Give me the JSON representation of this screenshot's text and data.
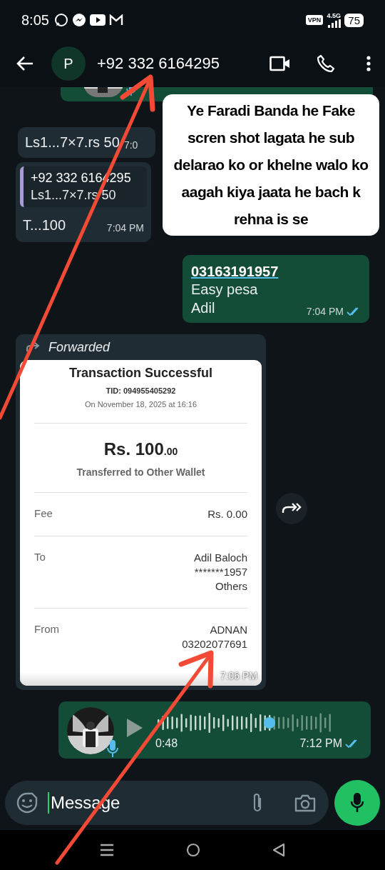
{
  "status_bar": {
    "time": "8:05",
    "vpn": "VPN",
    "network": "4.5G",
    "battery": "75"
  },
  "header": {
    "avatar_letter": "P",
    "contact": "+92 332 6164295"
  },
  "messages": [
    {
      "kind": "voice_partial"
    },
    {
      "kind": "text_in",
      "text": "Ls1...7×7.rs 50",
      "time": "7:0"
    },
    {
      "kind": "quote_in",
      "quote_author": "+92 332 6164295",
      "quote_text": "Ls1...7×7.rs 50",
      "text": "T...100",
      "time": "7:04 PM"
    },
    {
      "kind": "text_out",
      "link": "03163191957",
      "lines": [
        "Easy pesa",
        "Adil"
      ],
      "time": "7:04 PM",
      "read": true
    },
    {
      "kind": "receipt",
      "forwarded": "Forwarded",
      "title": "Transaction Successful",
      "tid": "TID: 094955405292",
      "date": "On November 18, 2025 at 16:16",
      "amount": "Rs. 100",
      "cents": ".00",
      "subtitle": "Transferred to Other Wallet",
      "rows": [
        {
          "label": "Fee",
          "values": [
            "Rs. 0.00"
          ]
        },
        {
          "label": "To",
          "values": [
            "Adil Baloch",
            "*******1957",
            "Others"
          ]
        },
        {
          "label": "From",
          "values": [
            "ADNAN",
            "03202077691"
          ]
        }
      ],
      "time": "7:06 PM"
    },
    {
      "kind": "voice_out",
      "duration": "0:48",
      "time": "7:12 PM",
      "level": 0.64,
      "read": true
    }
  ],
  "composer": {
    "placeholder": "Message"
  },
  "annotation": {
    "text": "Ye Faradi Banda he Fake scren shot lagata he sub delarao ko or khelne walo ko aagah kiya jaata he bach k rehna is se"
  }
}
